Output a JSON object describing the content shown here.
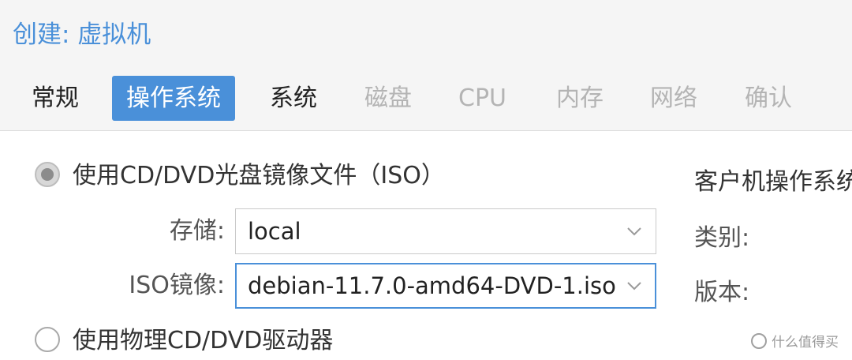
{
  "dialog": {
    "title": "创建: 虚拟机"
  },
  "tabs": [
    {
      "label": "常规",
      "state": "normal"
    },
    {
      "label": "操作系统",
      "state": "active"
    },
    {
      "label": "系统",
      "state": "normal"
    },
    {
      "label": "磁盘",
      "state": "disabled"
    },
    {
      "label": "CPU",
      "state": "disabled"
    },
    {
      "label": "内存",
      "state": "disabled"
    },
    {
      "label": "网络",
      "state": "disabled"
    },
    {
      "label": "确认",
      "state": "disabled"
    }
  ],
  "media": {
    "option_iso": {
      "label": "使用CD/DVD光盘镜像文件（ISO）",
      "checked": true
    },
    "storage": {
      "label": "存储:",
      "value": "local"
    },
    "iso_image": {
      "label": "ISO镜像:",
      "value": "debian-11.7.0-amd64-DVD-1.iso"
    },
    "option_physical": {
      "label": "使用物理CD/DVD驱动器",
      "checked": false
    }
  },
  "guest_os": {
    "heading": "客户机操作系统",
    "type_label": "类别:",
    "version_label": "版本:"
  },
  "watermark": {
    "text": "什么值得买"
  },
  "colors": {
    "accent": "#4a90d9",
    "header_bg": "#f5f5f5",
    "disabled_text": "#b4b4b4"
  }
}
